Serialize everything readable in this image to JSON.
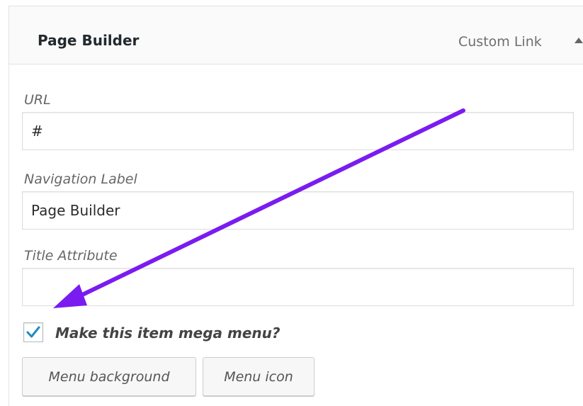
{
  "menu_item": {
    "title": "Page Builder",
    "type_label": "Custom Link"
  },
  "fields": {
    "url": {
      "label": "URL",
      "value": "#"
    },
    "nav_label": {
      "label": "Navigation Label",
      "value": "Page Builder"
    },
    "title_attr": {
      "label": "Title Attribute",
      "value": ""
    }
  },
  "mega_menu": {
    "label": "Make this item mega menu?",
    "checked": true
  },
  "buttons": {
    "background": "Menu background",
    "icon": "Menu icon"
  },
  "colors": {
    "annotation_arrow": "#7a1cf0",
    "checkmark": "#1e8cbe"
  }
}
